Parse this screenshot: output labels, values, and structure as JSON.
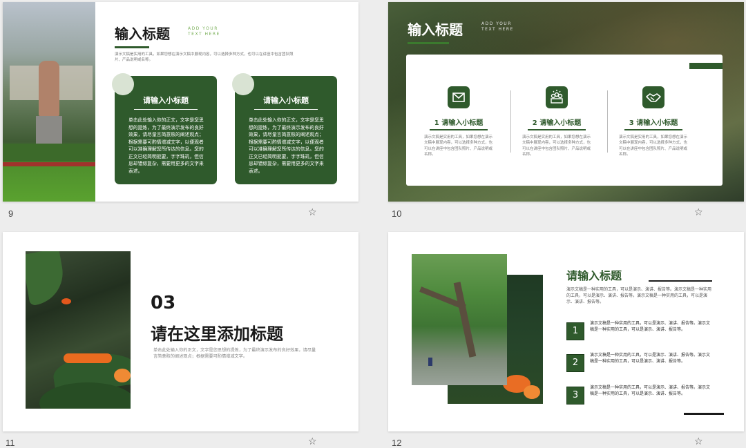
{
  "slides": {
    "s9": {
      "number": "9",
      "title": "输入标题",
      "en_sub": "ADD YOUR\nTEXT HERE",
      "desc": "演示文稿是实用的工具，如果您想在演示文稿中展现内容，可以选择多种方式，也可以在讲座中包含团队照片、产品说明或名称。",
      "cards": [
        {
          "title": "请输入小标题",
          "body": "单击此处输入你的正文，文字是您思想的提炼，为了最终演示发布的良好效果，请尽量言简意赅的阐述观点；根据需要可酌情增减文字，以便观者可以准确理解您所传达的信息。您的正文已经简明扼要，字字珠玑，但信息却错综复杂，需要用更多的文字来表述。"
        },
        {
          "title": "请输入小标题",
          "body": "单击此处输入你的正文，文字是您思想的提炼，为了最终演示发布的良好效果，请尽量言简意赅的阐述观点；根据需要可酌情增减文字，以便观者可以准确理解您所传达的信息。您的正文已经简明扼要，字字珠玑，但信息却错综复杂，需要用更多的文字来表述。"
        }
      ]
    },
    "s10": {
      "number": "10",
      "title": "输入标题",
      "en_sub": "ADD YOUR\nTEXT HERE",
      "items": [
        {
          "icon": "mail-icon",
          "title": "1 请输入小标题",
          "body": "演示文稿是实用的工具，如果您想在演示文稿中展现内容，可以选择多种方式，也可以在讲座中包含团队照片、产品说明或名称。"
        },
        {
          "icon": "team-icon",
          "title": "2 请输入小标题",
          "body": "演示文稿是实用的工具，如果您想在演示文稿中展现内容，可以选择多种方式，也可以在讲座中包含团队照片、产品说明或名称。"
        },
        {
          "icon": "handshake-icon",
          "title": "3 请输入小标题",
          "body": "演示文稿是实用的工具，如果您想在演示文稿中展现内容，可以选择多种方式，也可以在讲座中包含团队照片、产品说明或名称。"
        }
      ]
    },
    "s11": {
      "number": "11",
      "section_no": "03",
      "title": "请在这里添加标题",
      "body": "单击此处输入你的正文，文字是您思想的提炼，为了最终演示发布的良好效果，请尽量言简意赅的阐述观点；根据需要可酌情增减文字。"
    },
    "s12": {
      "number": "12",
      "title": "请输入标题",
      "desc": "演示文稿是一种实用的工具，可以是演示、演讲、报告等。演示文稿是一种实用的工具，可以是演示、演讲、报告等。演示文稿是一种实用的工具，可以是演示、演讲、报告等。",
      "points": [
        {
          "n": "1",
          "text": "演示文稿是一种实用的工具，可以是演示、演讲、报告等。演示文稿是一种实用的工具，可以是演示、演讲、报告等。"
        },
        {
          "n": "2",
          "text": "演示文稿是一种实用的工具，可以是演示、演讲、报告等。演示文稿是一种实用的工具，可以是演示、演讲、报告等。"
        },
        {
          "n": "3",
          "text": "演示文稿是一种实用的工具，可以是演示、演讲、报告等。演示文稿是一种实用的工具，可以是演示、演讲、报告等。"
        }
      ]
    }
  },
  "colors": {
    "accent": "#2f5a2c",
    "light_accent": "#a8c79a",
    "background": "#ededed"
  }
}
